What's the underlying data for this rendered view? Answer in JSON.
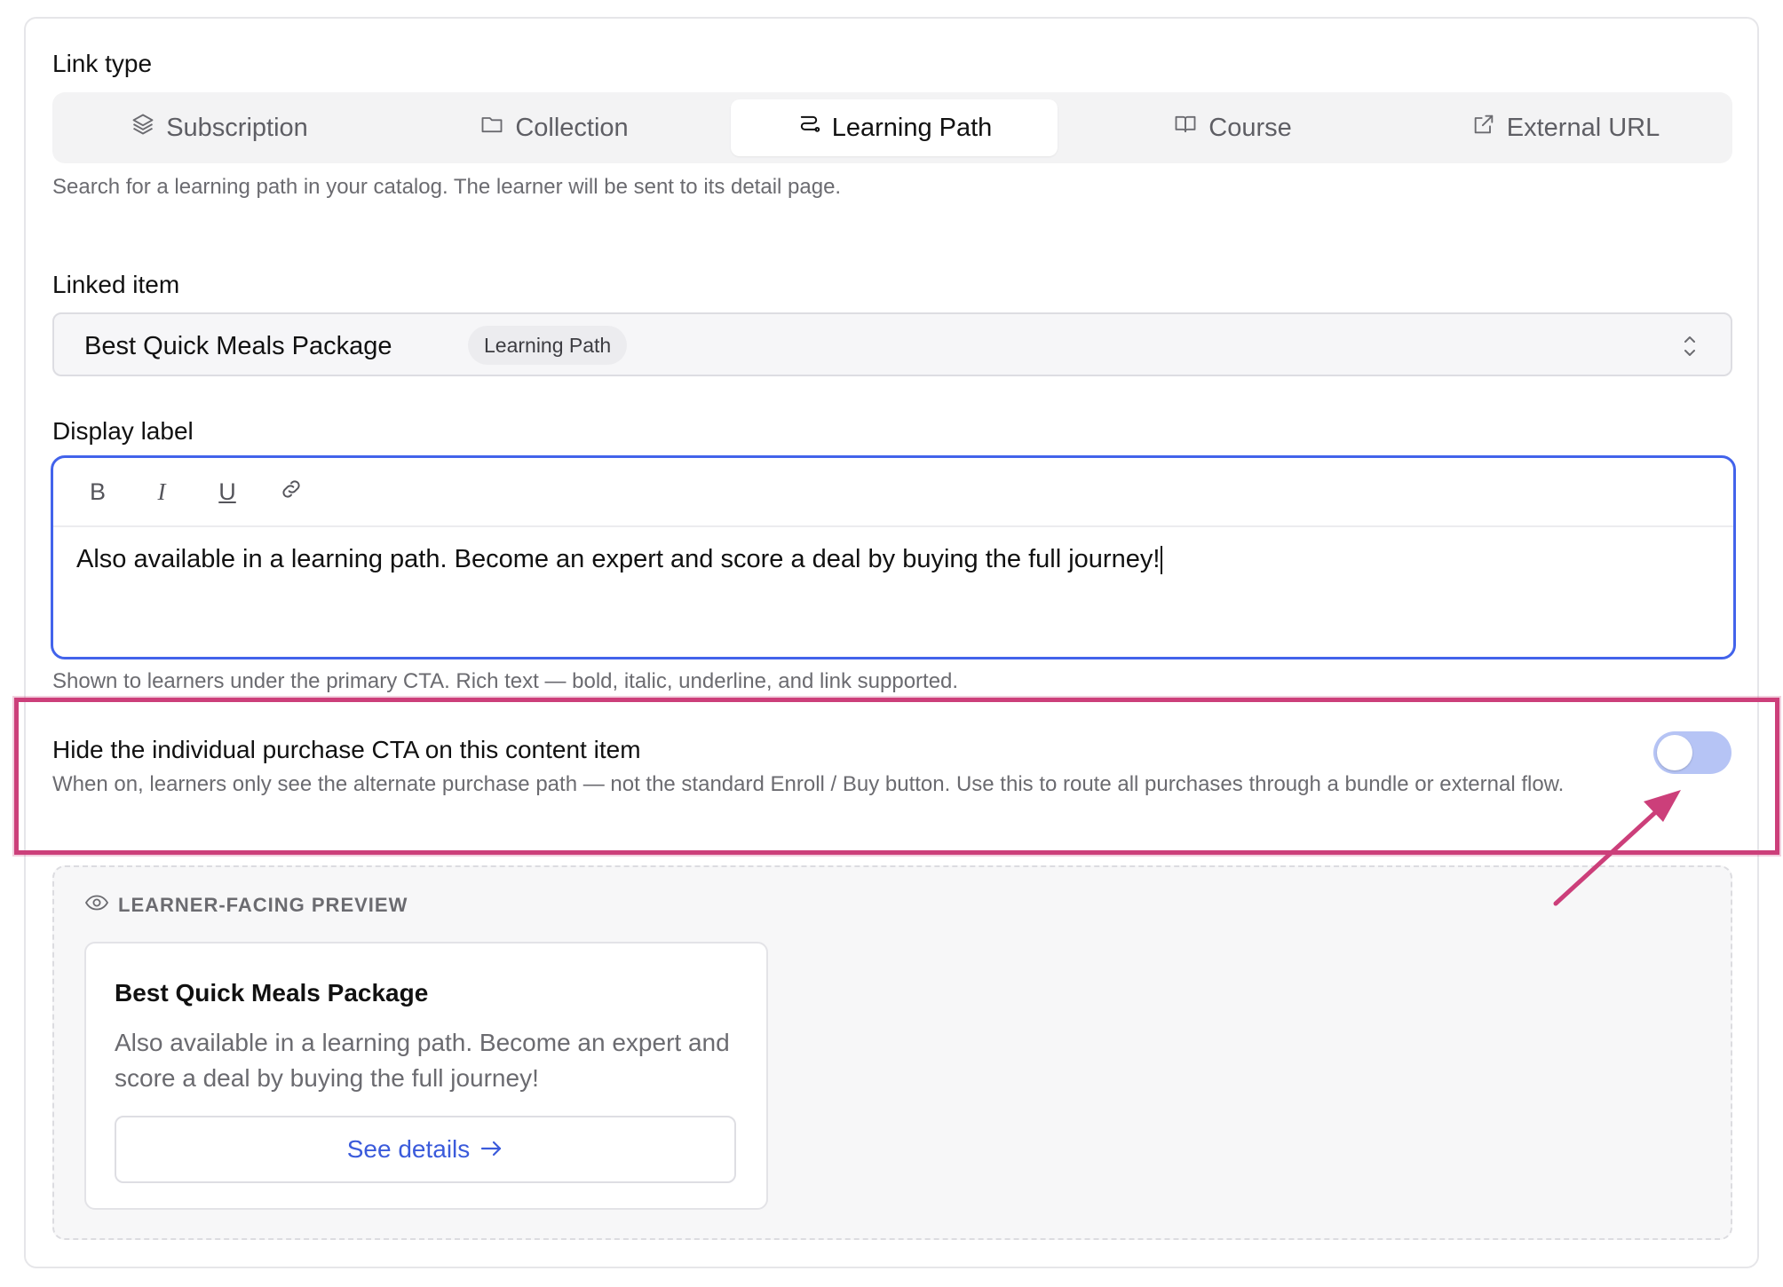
{
  "link_type": {
    "label": "Link type",
    "tabs": [
      {
        "label": "Subscription",
        "icon": "layers-icon"
      },
      {
        "label": "Collection",
        "icon": "folder-icon"
      },
      {
        "label": "Learning Path",
        "icon": "route-icon",
        "active": true
      },
      {
        "label": "Course",
        "icon": "book-icon"
      },
      {
        "label": "External URL",
        "icon": "external-link-icon"
      }
    ],
    "help": "Search for a learning path in your catalog. The learner will be sent to its detail page."
  },
  "linked_item": {
    "label": "Linked item",
    "value": "Best Quick Meals Package",
    "badge": "Learning Path"
  },
  "display_label": {
    "label": "Display label",
    "toolbar": [
      "B",
      "I",
      "U",
      "link"
    ],
    "text": "Also available in a learning path. Become an expert and score a deal by buying the full journey!",
    "help": "Shown to learners under the primary CTA. Rich text — bold, italic, underline, and link supported."
  },
  "hide_cta": {
    "title": "Hide the individual purchase CTA on this content item",
    "description": "When on, learners only see the alternate purchase path — not the standard Enroll / Buy button. Use this to route all purchases through a bundle or external flow.",
    "enabled": false
  },
  "preview": {
    "heading": "LEARNER-FACING PREVIEW",
    "card_title": "Best Quick Meals Package",
    "card_body": "Also available in a learning path. Become an expert and score a deal by buying the full journey!",
    "button_label": "See details"
  },
  "colors": {
    "accent": "#4263eb",
    "annotation": "#cc3f7a",
    "toggle_off": "#b6c4f5"
  }
}
